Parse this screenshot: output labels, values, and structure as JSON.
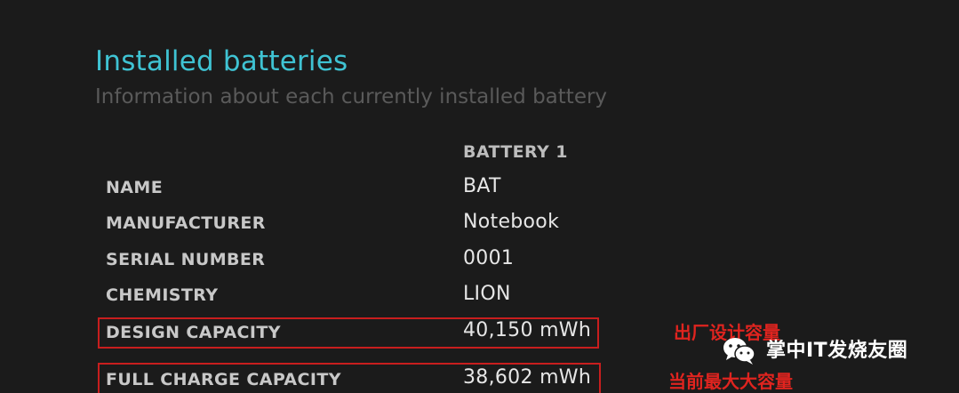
{
  "section": {
    "title": "Installed batteries",
    "subtitle": "Information about each currently installed battery"
  },
  "table": {
    "column_header": "BATTERY 1",
    "rows": [
      {
        "label": "NAME",
        "value": "BAT"
      },
      {
        "label": "MANUFACTURER",
        "value": "Notebook"
      },
      {
        "label": "SERIAL NUMBER",
        "value": "0001"
      },
      {
        "label": "CHEMISTRY",
        "value": "LION"
      },
      {
        "label": "DESIGN CAPACITY",
        "value": "40,150 mWh"
      },
      {
        "label": "FULL CHARGE CAPACITY",
        "value": "38,602 mWh"
      }
    ]
  },
  "annotations": {
    "design_capacity_note": "出厂设计容量",
    "full_charge_note": "当前最大大容量",
    "highlight_color": "#c81e1e",
    "note_color": "#e0241f"
  },
  "watermark": {
    "icon": "wechat-icon",
    "text": "掌中IT发烧友圈"
  },
  "colors": {
    "background": "#1b1b1b",
    "title": "#3fc3d3",
    "subtitle": "#5a5a5a"
  }
}
